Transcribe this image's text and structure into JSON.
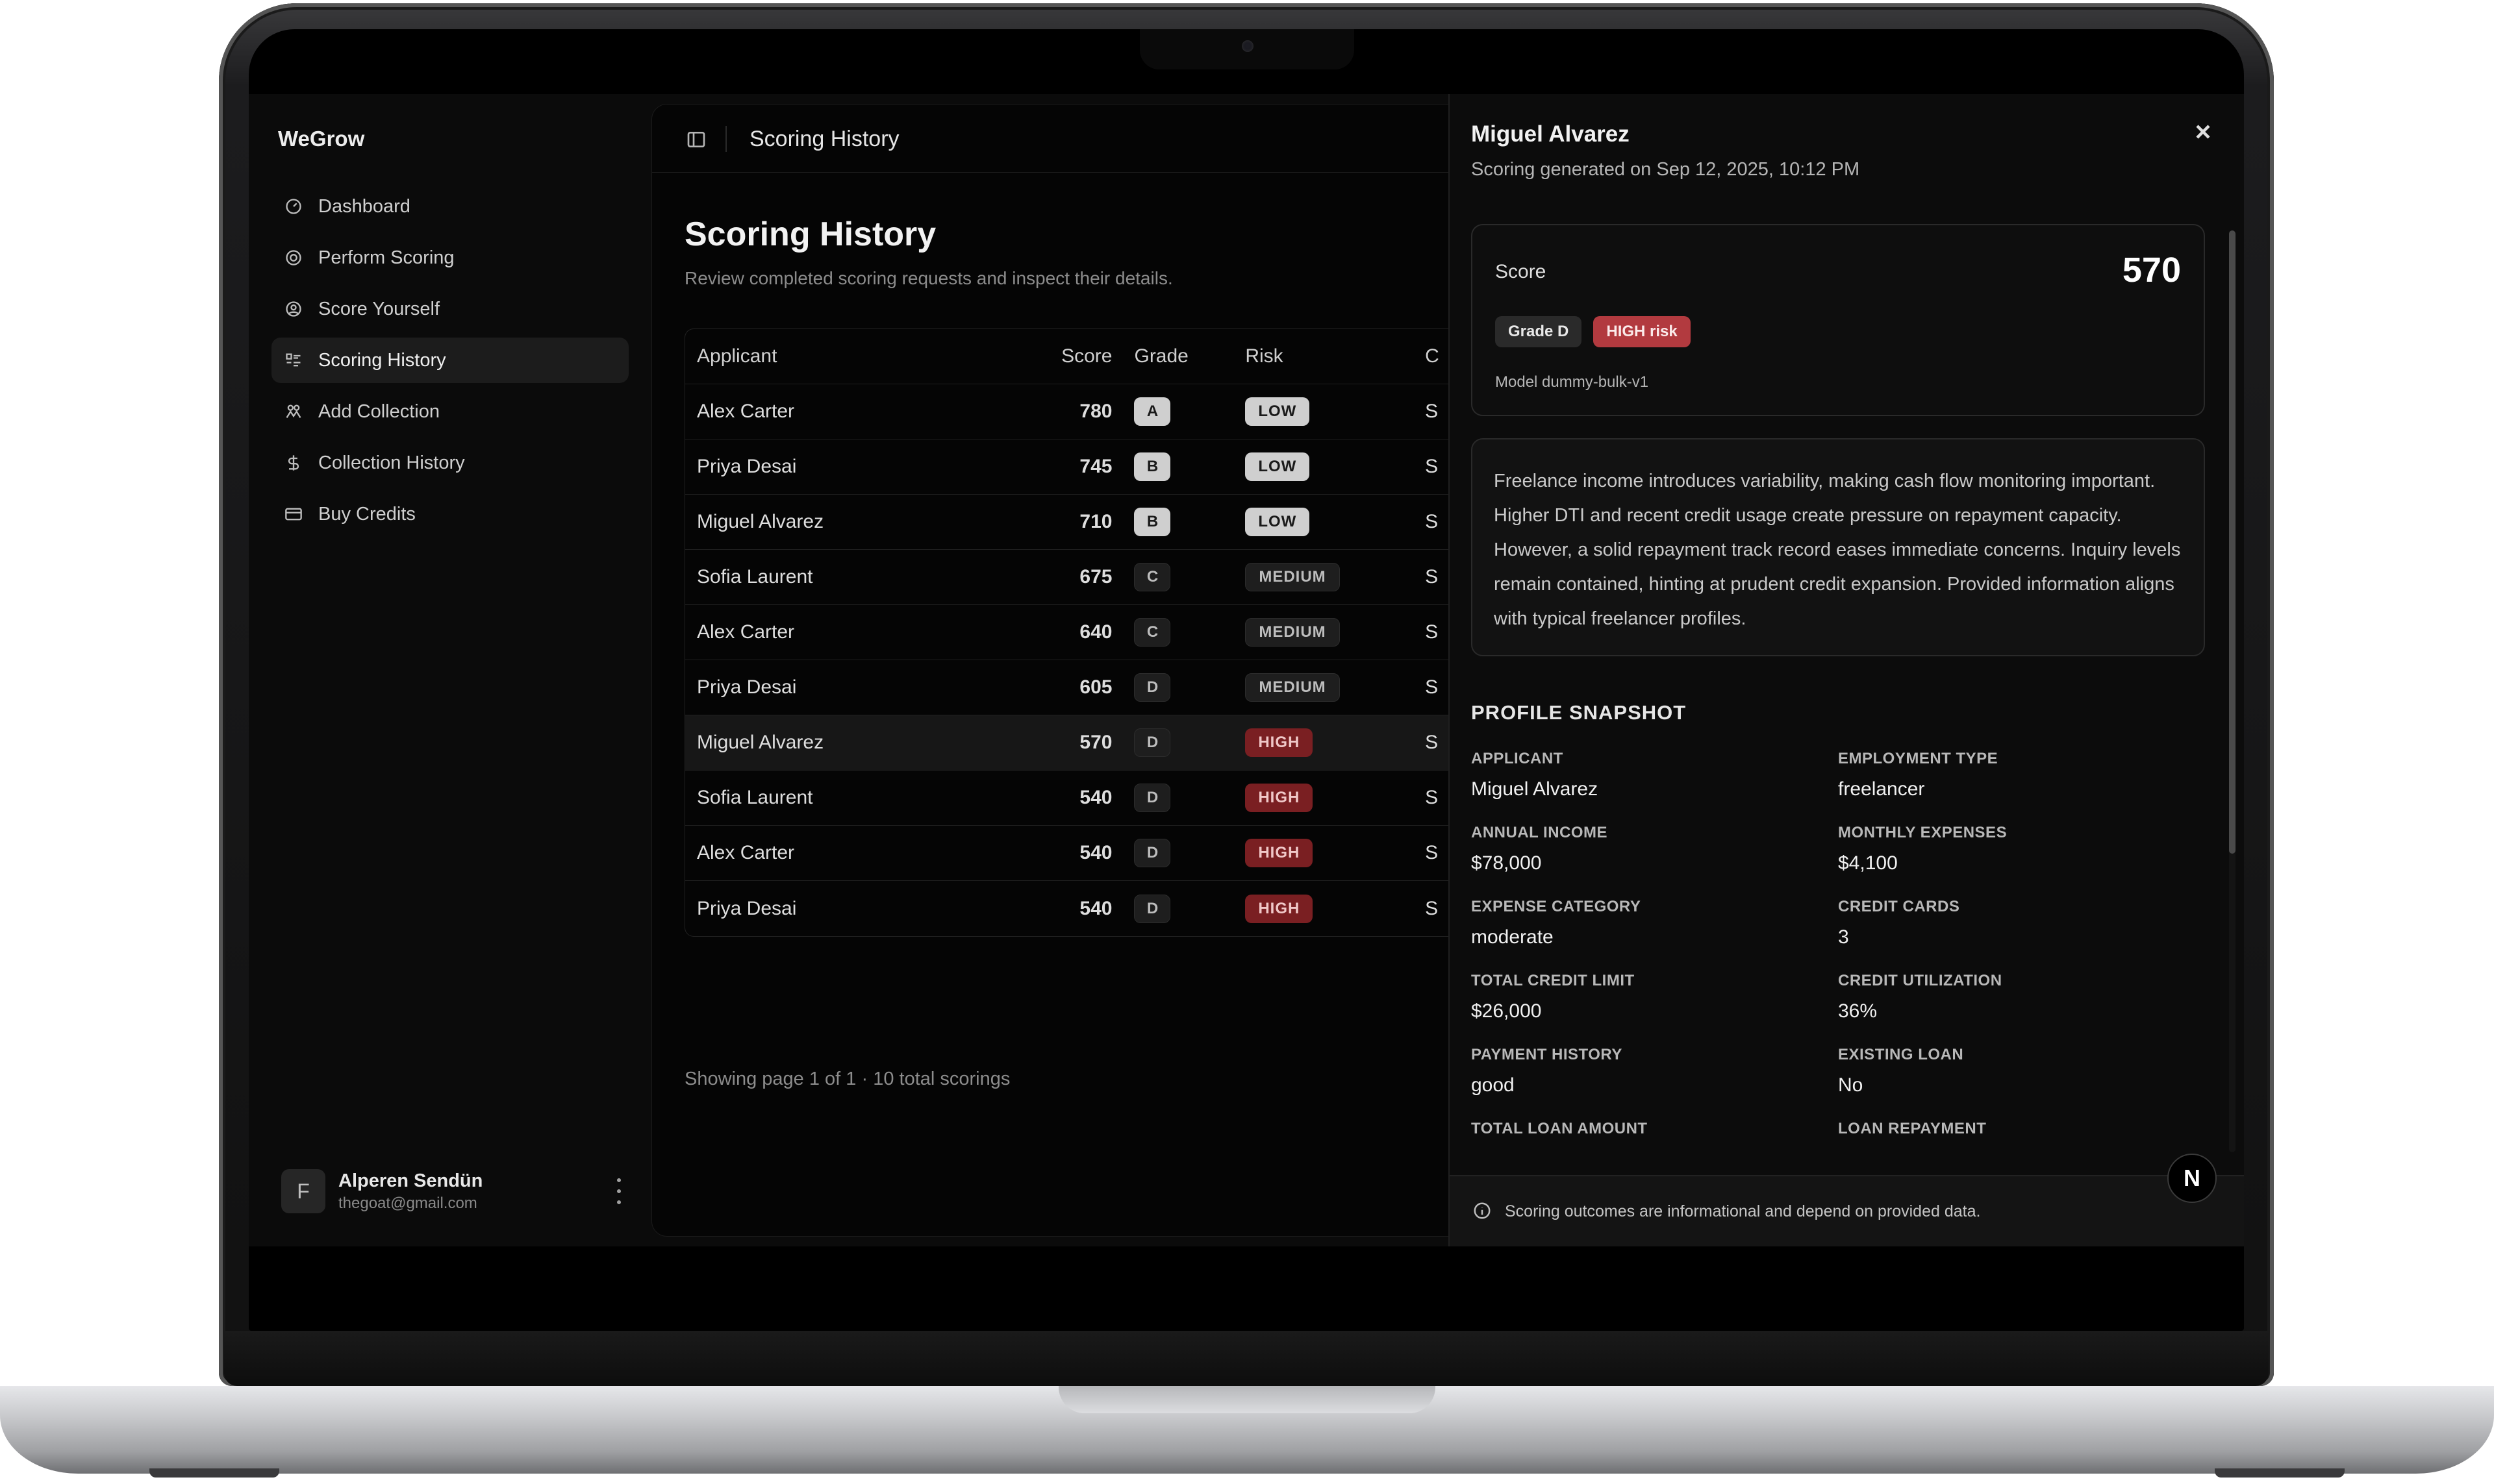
{
  "app": {
    "brand": "WeGrow"
  },
  "sidebar": {
    "items": [
      {
        "label": "Dashboard",
        "icon": "gauge-icon",
        "active": false
      },
      {
        "label": "Perform Scoring",
        "icon": "target-icon",
        "active": false
      },
      {
        "label": "Score Yourself",
        "icon": "user-circle-icon",
        "active": false
      },
      {
        "label": "Scoring History",
        "icon": "list-icon",
        "active": true
      },
      {
        "label": "Add Collection",
        "icon": "users-icon",
        "active": false
      },
      {
        "label": "Collection History",
        "icon": "dollar-icon",
        "active": false
      },
      {
        "label": "Buy Credits",
        "icon": "card-icon",
        "active": false
      }
    ],
    "user": {
      "initial": "F",
      "name": "Alperen Sendün",
      "email": "thegoat@gmail.com"
    }
  },
  "header": {
    "title": "Scoring History"
  },
  "main": {
    "title": "Scoring History",
    "subtitle": "Review completed scoring requests and inspect their details.",
    "table": {
      "columns": [
        "Applicant",
        "Score",
        "Grade",
        "Risk",
        "C"
      ],
      "rows": [
        {
          "applicant": "Alex Carter",
          "score": "780",
          "grade": "A",
          "risk": "LOW",
          "more": "S"
        },
        {
          "applicant": "Priya Desai",
          "score": "745",
          "grade": "B",
          "risk": "LOW",
          "more": "S"
        },
        {
          "applicant": "Miguel Alvarez",
          "score": "710",
          "grade": "B",
          "risk": "LOW",
          "more": "S"
        },
        {
          "applicant": "Sofia Laurent",
          "score": "675",
          "grade": "C",
          "risk": "MEDIUM",
          "more": "S"
        },
        {
          "applicant": "Alex Carter",
          "score": "640",
          "grade": "C",
          "risk": "MEDIUM",
          "more": "S"
        },
        {
          "applicant": "Priya Desai",
          "score": "605",
          "grade": "D",
          "risk": "MEDIUM",
          "more": "S"
        },
        {
          "applicant": "Miguel Alvarez",
          "score": "570",
          "grade": "D",
          "risk": "HIGH",
          "more": "S"
        },
        {
          "applicant": "Sofia Laurent",
          "score": "540",
          "grade": "D",
          "risk": "HIGH",
          "more": "S"
        },
        {
          "applicant": "Alex Carter",
          "score": "540",
          "grade": "D",
          "risk": "HIGH",
          "more": "S"
        },
        {
          "applicant": "Priya Desai",
          "score": "540",
          "grade": "D",
          "risk": "HIGH",
          "more": "S"
        }
      ],
      "selected_row": 6
    },
    "footer": "Showing page 1 of 1 · 10 total scorings"
  },
  "drawer": {
    "name": "Miguel Alvarez",
    "generated": "Scoring generated on Sep 12, 2025, 10:12 PM",
    "score_label": "Score",
    "score_value": "570",
    "grade_badge": "Grade D",
    "risk_badge": "HIGH risk",
    "model": "Model dummy-bulk-v1",
    "summary": "Freelance income introduces variability, making cash flow monitoring important. Higher DTI and recent credit usage create pressure on repayment capacity. However, a solid repayment track record eases immediate concerns. Inquiry levels remain contained, hinting at prudent credit expansion. Provided information aligns with typical freelancer profiles.",
    "snapshot_title": "PROFILE SNAPSHOT",
    "snapshot": [
      {
        "label": "APPLICANT",
        "value": "Miguel Alvarez"
      },
      {
        "label": "EMPLOYMENT TYPE",
        "value": "freelancer"
      },
      {
        "label": "ANNUAL INCOME",
        "value": "$78,000"
      },
      {
        "label": "MONTHLY EXPENSES",
        "value": "$4,100"
      },
      {
        "label": "EXPENSE CATEGORY",
        "value": "moderate"
      },
      {
        "label": "CREDIT CARDS",
        "value": "3"
      },
      {
        "label": "TOTAL CREDIT LIMIT",
        "value": "$26,000"
      },
      {
        "label": "CREDIT UTILIZATION",
        "value": "36%"
      },
      {
        "label": "PAYMENT HISTORY",
        "value": "good"
      },
      {
        "label": "EXISTING LOAN",
        "value": "No"
      },
      {
        "label": "TOTAL LOAN AMOUNT",
        "value": ""
      },
      {
        "label": "LOAN REPAYMENT",
        "value": ""
      }
    ],
    "footer_note": "Scoring outcomes are informational and depend on provided data.",
    "badge_letter": "N"
  },
  "colors": {
    "high": "#b23a3f",
    "low": "#cfcfcf",
    "background": "#0b0b0b"
  }
}
